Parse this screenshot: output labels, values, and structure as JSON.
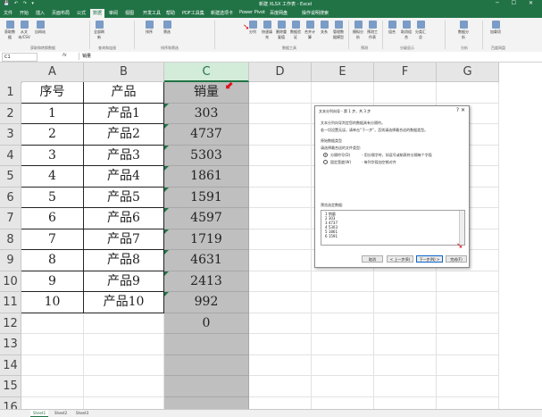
{
  "titlebar": {
    "document": "新建 XLSX 工作表 - Excel",
    "quick_access": "💾 ↶ ↷ ▾",
    "window_controls": "─ ☐ ✕"
  },
  "tabs": [
    "文件",
    "开始",
    "插入",
    "页面布局",
    "公式",
    "数据",
    "审阅",
    "视图",
    "开发工具",
    "帮助",
    "PDF工具集",
    "新建选项卡",
    "Power Pivot",
    "百度网盘",
    "操作说明搜索"
  ],
  "active_tab": "数据",
  "ribbon": {
    "buttons": [
      "获取数据",
      "从文本/CSV",
      "自网站",
      "全部刷新",
      "排序",
      "筛选",
      "分列",
      "快速填充",
      "删除重复值",
      "数据验证",
      "合并计算",
      "关系",
      "管理数据模型",
      "模拟分析",
      "预测工作表",
      "组合",
      "取消组合",
      "分类汇总",
      "数据分析",
      "加载项"
    ],
    "groups": [
      "获取和转换数据",
      "查询和连接",
      "排序和筛选",
      "数据工具",
      "预测",
      "分级显示",
      "分析",
      "百度网盘"
    ]
  },
  "formula_bar": {
    "name_box": "C1",
    "fx": "fx",
    "content": "销量"
  },
  "columns": [
    "A",
    "B",
    "C",
    "D",
    "E",
    "F",
    "G"
  ],
  "rows": [
    "1",
    "2",
    "3",
    "4",
    "5",
    "6",
    "7",
    "8",
    "9",
    "10",
    "11",
    "12",
    "13",
    "14",
    "15",
    "16"
  ],
  "table": {
    "headers": [
      "序号",
      "产品",
      "销量"
    ],
    "rows": [
      [
        "1",
        "产品1",
        "303"
      ],
      [
        "2",
        "产品2",
        "4737"
      ],
      [
        "3",
        "产品3",
        "5303"
      ],
      [
        "4",
        "产品4",
        "1861"
      ],
      [
        "5",
        "产品5",
        "1591"
      ],
      [
        "6",
        "产品6",
        "4597"
      ],
      [
        "7",
        "产品7",
        "1719"
      ],
      [
        "8",
        "产品8",
        "4631"
      ],
      [
        "9",
        "产品9",
        "2413"
      ],
      [
        "10",
        "产品10",
        "992"
      ]
    ],
    "c12_value": "0"
  },
  "sheets": [
    "Sheet1",
    "Sheet2",
    "Sheet3"
  ],
  "dialog": {
    "title": "文本分列向导 - 第 1 步，共 3 步",
    "close": "?  ✕",
    "intro1": "文本分列向导判定您的数据具有分隔符。",
    "intro2": "若一切设置无误，请单击“下一步”，否则请选择最合适的数据类型。",
    "section": "原始数据类型",
    "prompt": "请选择最合适的文件类型:",
    "option1_label": "分隔符号(D)",
    "option1_desc": "- 用分隔字符，如逗号或制表符分隔每个字段",
    "option2_label": "固定宽度(W)",
    "option2_desc": "- 每列字段加空格对齐",
    "preview_label": "预览选定数据:",
    "preview_rows": [
      "1 销量",
      "2 303",
      "3 4737",
      "4 5303",
      "5 1861",
      "6 1591"
    ],
    "buttons": {
      "cancel": "取消",
      "back": "< 上一步(B)",
      "next": "下一步(N) >",
      "finish": "完成(F)"
    }
  },
  "colors": {
    "brand": "#217346",
    "selection": "#bfbfbf",
    "annotation": "#e0101a"
  }
}
